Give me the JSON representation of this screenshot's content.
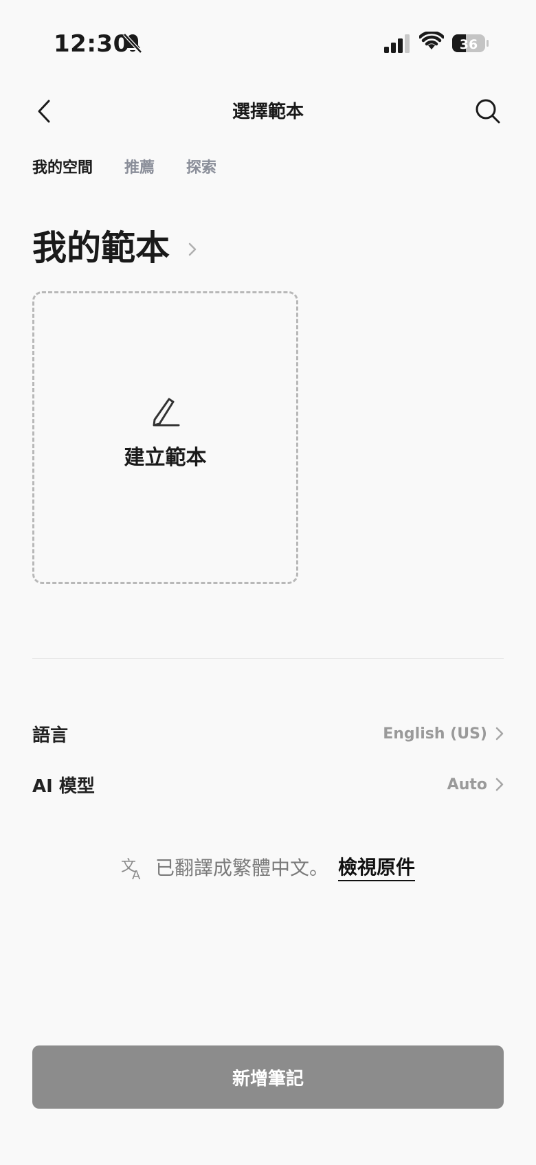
{
  "status_bar": {
    "time": "12:30",
    "battery": "36"
  },
  "header": {
    "title": "選擇範本"
  },
  "tabs": [
    {
      "label": "我的空間",
      "active": true
    },
    {
      "label": "推薦",
      "active": false
    },
    {
      "label": "探索",
      "active": false
    }
  ],
  "section": {
    "title": "我的範本"
  },
  "create_card": {
    "label": "建立範本"
  },
  "settings": [
    {
      "label": "語言",
      "value": "English (US)"
    },
    {
      "label": "AI 模型",
      "value": "Auto"
    }
  ],
  "translation": {
    "notice": "已翻譯成繁體中文。",
    "link": "檢視原件"
  },
  "footer": {
    "button_label": "新增筆記"
  },
  "colors": {
    "background": "#f9f9f9",
    "text": "#1a1a1a",
    "muted": "#8a8e99",
    "button": "#8c8c8c"
  }
}
